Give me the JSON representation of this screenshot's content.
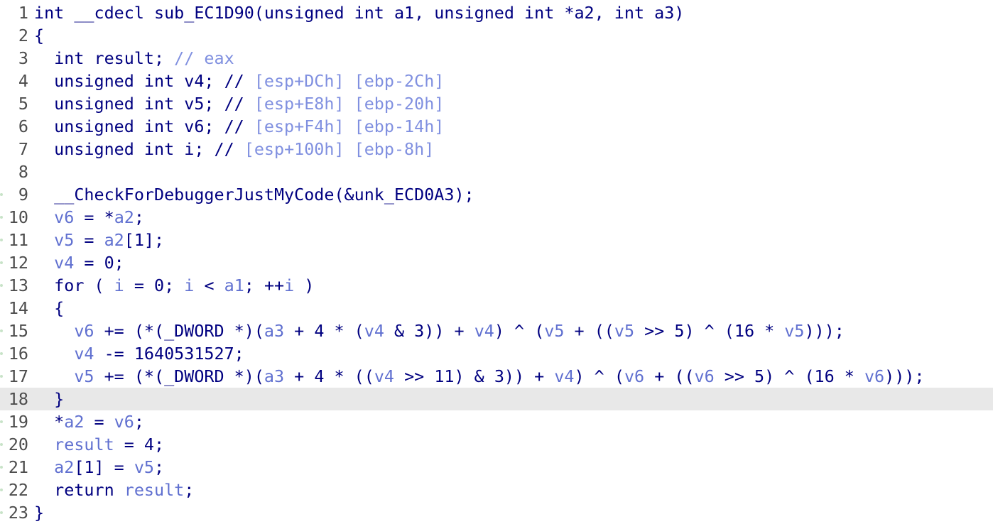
{
  "editor": {
    "highlighted_line": 18,
    "colors": {
      "code": "#000080",
      "variable": "#6070d0",
      "comment": "#8090e0",
      "line_number": "#4d4d4d",
      "highlight": "#e8e8e8",
      "breakpoint_marker": "#c8e3c8"
    },
    "lines": [
      {
        "num": "1",
        "marker": false,
        "tokens": [
          {
            "t": "int __cdecl sub_EC1D90(unsigned int a1, unsigned int *a2, int a3)",
            "k": "code"
          }
        ]
      },
      {
        "num": "2",
        "marker": false,
        "tokens": [
          {
            "t": "{",
            "k": "code"
          }
        ]
      },
      {
        "num": "3",
        "marker": false,
        "tokens": [
          {
            "t": "  int result; ",
            "k": "code"
          },
          {
            "t": "// eax",
            "k": "cmt"
          }
        ]
      },
      {
        "num": "4",
        "marker": false,
        "tokens": [
          {
            "t": "  unsigned int v4; // ",
            "k": "code"
          },
          {
            "t": "[esp+DCh] [ebp-2Ch]",
            "k": "cmt"
          }
        ]
      },
      {
        "num": "5",
        "marker": false,
        "tokens": [
          {
            "t": "  unsigned int v5; // ",
            "k": "code"
          },
          {
            "t": "[esp+E8h] [ebp-20h]",
            "k": "cmt"
          }
        ]
      },
      {
        "num": "6",
        "marker": false,
        "tokens": [
          {
            "t": "  unsigned int v6; // ",
            "k": "code"
          },
          {
            "t": "[esp+F4h] [ebp-14h]",
            "k": "cmt"
          }
        ]
      },
      {
        "num": "7",
        "marker": false,
        "tokens": [
          {
            "t": "  unsigned int i; // ",
            "k": "code"
          },
          {
            "t": "[esp+100h] [ebp-8h]",
            "k": "cmt"
          }
        ]
      },
      {
        "num": "8",
        "marker": false,
        "tokens": []
      },
      {
        "num": "9",
        "marker": true,
        "tokens": [
          {
            "t": "  __CheckForDebuggerJustMyCode(&unk_ECD0A3);",
            "k": "code"
          }
        ]
      },
      {
        "num": "10",
        "marker": true,
        "tokens": [
          {
            "t": "  ",
            "k": "code"
          },
          {
            "t": "v6",
            "k": "var"
          },
          {
            "t": " = *",
            "k": "code"
          },
          {
            "t": "a2",
            "k": "var"
          },
          {
            "t": ";",
            "k": "code"
          }
        ]
      },
      {
        "num": "11",
        "marker": true,
        "tokens": [
          {
            "t": "  ",
            "k": "code"
          },
          {
            "t": "v5",
            "k": "var"
          },
          {
            "t": " = ",
            "k": "code"
          },
          {
            "t": "a2",
            "k": "var"
          },
          {
            "t": "[1];",
            "k": "code"
          }
        ]
      },
      {
        "num": "12",
        "marker": true,
        "tokens": [
          {
            "t": "  ",
            "k": "code"
          },
          {
            "t": "v4",
            "k": "var"
          },
          {
            "t": " = 0;",
            "k": "code"
          }
        ]
      },
      {
        "num": "13",
        "marker": true,
        "tokens": [
          {
            "t": "  for ( ",
            "k": "code"
          },
          {
            "t": "i",
            "k": "var"
          },
          {
            "t": " = 0; ",
            "k": "code"
          },
          {
            "t": "i",
            "k": "var"
          },
          {
            "t": " < ",
            "k": "code"
          },
          {
            "t": "a1",
            "k": "var"
          },
          {
            "t": "; ++",
            "k": "code"
          },
          {
            "t": "i",
            "k": "var"
          },
          {
            "t": " )",
            "k": "code"
          }
        ]
      },
      {
        "num": "14",
        "marker": false,
        "tokens": [
          {
            "t": "  {",
            "k": "code"
          }
        ]
      },
      {
        "num": "15",
        "marker": true,
        "tokens": [
          {
            "t": "    ",
            "k": "code"
          },
          {
            "t": "v6",
            "k": "var"
          },
          {
            "t": " += (*(_DWORD *)(",
            "k": "code"
          },
          {
            "t": "a3",
            "k": "var"
          },
          {
            "t": " + 4 * (",
            "k": "code"
          },
          {
            "t": "v4",
            "k": "var"
          },
          {
            "t": " & 3)) + ",
            "k": "code"
          },
          {
            "t": "v4",
            "k": "var"
          },
          {
            "t": ") ^ (",
            "k": "code"
          },
          {
            "t": "v5",
            "k": "var"
          },
          {
            "t": " + ((",
            "k": "code"
          },
          {
            "t": "v5",
            "k": "var"
          },
          {
            "t": " >> 5) ^ (16 * ",
            "k": "code"
          },
          {
            "t": "v5",
            "k": "var"
          },
          {
            "t": ")));",
            "k": "code"
          }
        ]
      },
      {
        "num": "16",
        "marker": true,
        "tokens": [
          {
            "t": "    ",
            "k": "code"
          },
          {
            "t": "v4",
            "k": "var"
          },
          {
            "t": " -= 1640531527;",
            "k": "code"
          }
        ]
      },
      {
        "num": "17",
        "marker": true,
        "tokens": [
          {
            "t": "    ",
            "k": "code"
          },
          {
            "t": "v5",
            "k": "var"
          },
          {
            "t": " += (*(_DWORD *)(",
            "k": "code"
          },
          {
            "t": "a3",
            "k": "var"
          },
          {
            "t": " + 4 * ((",
            "k": "code"
          },
          {
            "t": "v4",
            "k": "var"
          },
          {
            "t": " >> 11) & 3)) + ",
            "k": "code"
          },
          {
            "t": "v4",
            "k": "var"
          },
          {
            "t": ") ^ (",
            "k": "code"
          },
          {
            "t": "v6",
            "k": "var"
          },
          {
            "t": " + ((",
            "k": "code"
          },
          {
            "t": "v6",
            "k": "var"
          },
          {
            "t": " >> 5) ^ (16 * ",
            "k": "code"
          },
          {
            "t": "v6",
            "k": "var"
          },
          {
            "t": ")));",
            "k": "code"
          }
        ]
      },
      {
        "num": "18",
        "marker": false,
        "tokens": [
          {
            "t": "  }",
            "k": "code"
          }
        ]
      },
      {
        "num": "19",
        "marker": true,
        "tokens": [
          {
            "t": "  *",
            "k": "code"
          },
          {
            "t": "a2",
            "k": "var"
          },
          {
            "t": " = ",
            "k": "code"
          },
          {
            "t": "v6",
            "k": "var"
          },
          {
            "t": ";",
            "k": "code"
          }
        ]
      },
      {
        "num": "20",
        "marker": true,
        "tokens": [
          {
            "t": "  ",
            "k": "code"
          },
          {
            "t": "result",
            "k": "var"
          },
          {
            "t": " = 4;",
            "k": "code"
          }
        ]
      },
      {
        "num": "21",
        "marker": true,
        "tokens": [
          {
            "t": "  ",
            "k": "code"
          },
          {
            "t": "a2",
            "k": "var"
          },
          {
            "t": "[1] = ",
            "k": "code"
          },
          {
            "t": "v5",
            "k": "var"
          },
          {
            "t": ";",
            "k": "code"
          }
        ]
      },
      {
        "num": "22",
        "marker": true,
        "tokens": [
          {
            "t": "  return ",
            "k": "code"
          },
          {
            "t": "result",
            "k": "var"
          },
          {
            "t": ";",
            "k": "code"
          }
        ]
      },
      {
        "num": "23",
        "marker": true,
        "tokens": [
          {
            "t": "}",
            "k": "code"
          }
        ]
      }
    ]
  }
}
